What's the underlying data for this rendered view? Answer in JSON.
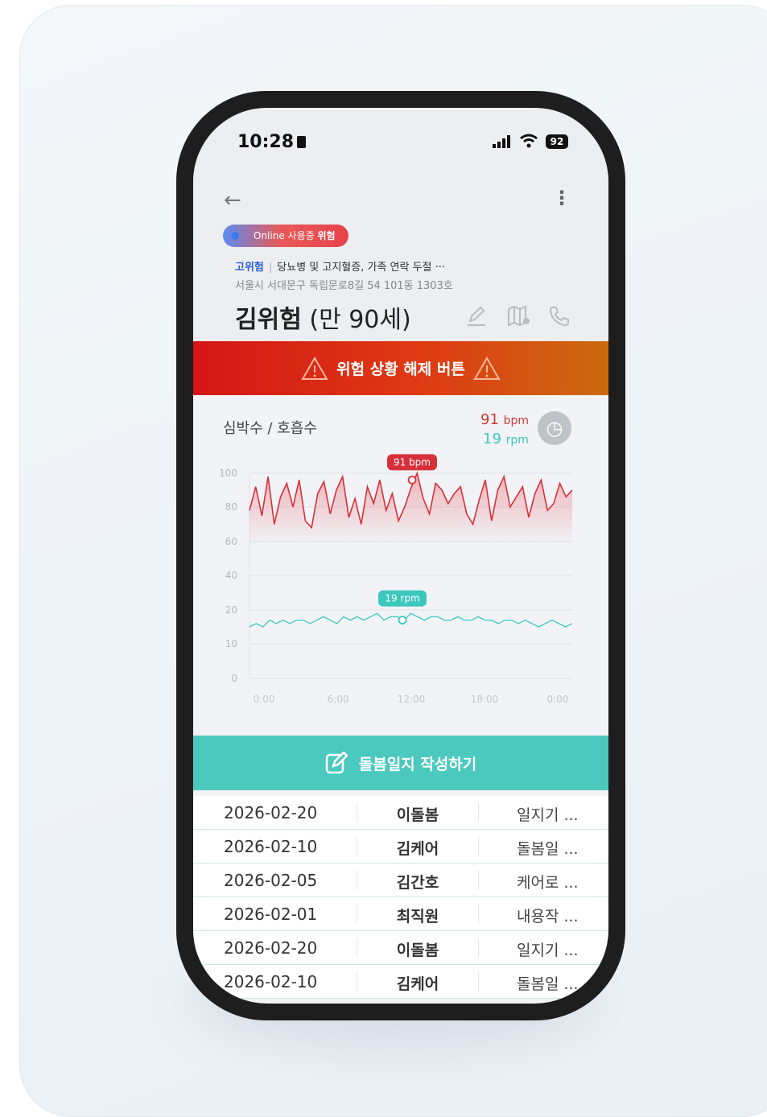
{
  "status_bar": {
    "time": "10:28",
    "battery": "92"
  },
  "header": {
    "badge": {
      "online": "Online",
      "state": "사용중",
      "level": "위험"
    },
    "risk_level": "고위험",
    "conditions": "당뇨병 및 고지혈증, 가족 연락 두절",
    "conditions_more": "···",
    "address": "서울시 서대문구 독립문로8길 54 101동 1303호",
    "name": "김위험",
    "age": "(만 90세)"
  },
  "alarm_button": {
    "label": "위험 상황 해제 버튼"
  },
  "vitals": {
    "title": "심박수 / 호흡수",
    "heart_rate": {
      "value": "91",
      "unit": "bpm"
    },
    "resp_rate": {
      "value": "19",
      "unit": "rpm"
    }
  },
  "chart_data": {
    "type": "line",
    "y_ticks": [
      "100",
      "80",
      "60",
      "40",
      "20",
      "10",
      "0"
    ],
    "x_ticks": [
      "0:00",
      "6:00",
      "12:00",
      "18:00",
      "0:00"
    ],
    "series": [
      {
        "name": "심박수",
        "unit": "bpm",
        "color": "#d8303a",
        "values": [
          78,
          92,
          75,
          98,
          70,
          86,
          94,
          80,
          96,
          72,
          68,
          88,
          95,
          76,
          90,
          98,
          74,
          85,
          70,
          92,
          82,
          96,
          78,
          88,
          72,
          80,
          91,
          100,
          85,
          76,
          94,
          90,
          82,
          88,
          92,
          76,
          70,
          84,
          96,
          72,
          90,
          98,
          80,
          86,
          92,
          74,
          88,
          96,
          78,
          82,
          94,
          86,
          90
        ]
      },
      {
        "name": "호흡수",
        "unit": "rpm",
        "color": "#3cc7bd",
        "values": [
          15,
          16,
          15,
          17,
          16,
          17,
          16,
          17,
          17,
          16,
          17,
          18,
          17,
          16,
          18,
          17,
          18,
          17,
          18,
          19,
          17,
          18,
          18,
          17,
          19,
          18,
          17,
          18,
          18,
          17,
          17,
          18,
          17,
          17,
          18,
          17,
          17,
          16,
          17,
          17,
          16,
          17,
          16,
          15,
          16,
          17,
          16,
          15,
          16
        ]
      }
    ],
    "callouts": [
      {
        "label": "91 bpm",
        "series": 0,
        "value": 91
      },
      {
        "label": "19 rpm",
        "series": 1,
        "value": 19
      }
    ],
    "grid": true
  },
  "care_button": {
    "label": "돌봄일지 작성하기"
  },
  "care_log": [
    {
      "date": "2026-02-20",
      "author": "이돌봄",
      "preview": "일지기 ..."
    },
    {
      "date": "2026-02-10",
      "author": "김케어",
      "preview": "돌봄일 ..."
    },
    {
      "date": "2026-02-05",
      "author": "김간호",
      "preview": "케어로 ..."
    },
    {
      "date": "2026-02-01",
      "author": "최직원",
      "preview": "내용작 ..."
    },
    {
      "date": "2026-02-20",
      "author": "이돌봄",
      "preview": "일지기 ..."
    },
    {
      "date": "2026-02-10",
      "author": "김케어",
      "preview": "돌봄일 ..."
    }
  ],
  "icons": [
    "back-arrow-icon",
    "more-vert-icon",
    "edit-icon",
    "map-icon",
    "phone-icon",
    "warning-icon",
    "history-clock-icon",
    "write-icon"
  ]
}
